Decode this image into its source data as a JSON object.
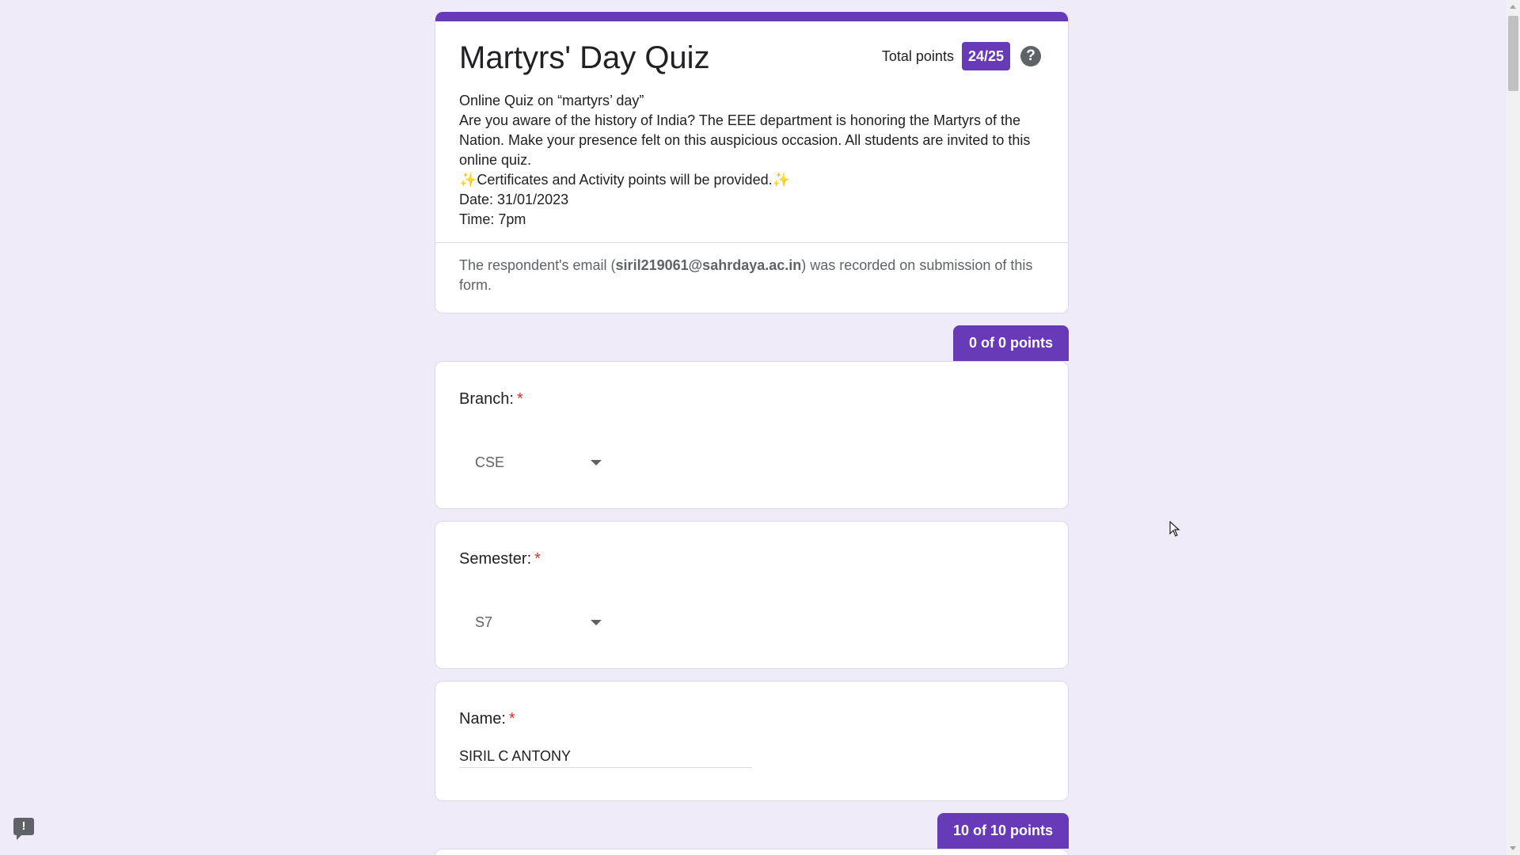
{
  "form": {
    "title": "Martyrs' Day Quiz",
    "total_points_label": "Total points",
    "total_score": "24/25",
    "help_glyph": "?",
    "description_lines": [
      "Online Quiz on “martyrs’ day”",
      "Are you aware of the history of India? The EEE department is honoring the Martyrs of the Nation. Make your presence felt on this auspicious occasion. All students are invited to this online quiz.",
      "✨Certificates and Activity points will be provided.✨",
      "Date: 31/01/2023",
      "Time: 7pm"
    ],
    "email_note_prefix": "The respondent's email (",
    "email": "siril219061@sahrdaya.ac.in",
    "email_note_suffix": ") was recorded on submission of this form."
  },
  "sections": [
    {
      "points_label": "0 of 0 points",
      "questions": [
        {
          "title": "Branch:",
          "required": "*",
          "type": "dropdown",
          "selected": "CSE"
        },
        {
          "title": "Semester:",
          "required": "*",
          "type": "dropdown",
          "selected": "S7"
        },
        {
          "title": "Name:",
          "required": "*",
          "type": "text",
          "value": "SIRIL C ANTONY"
        }
      ]
    },
    {
      "points_label": "10 of 10 points"
    }
  ],
  "feedback_glyph": "!",
  "colors": {
    "accent": "#673ab7",
    "background": "#f0ebf8",
    "required": "#d93025"
  }
}
